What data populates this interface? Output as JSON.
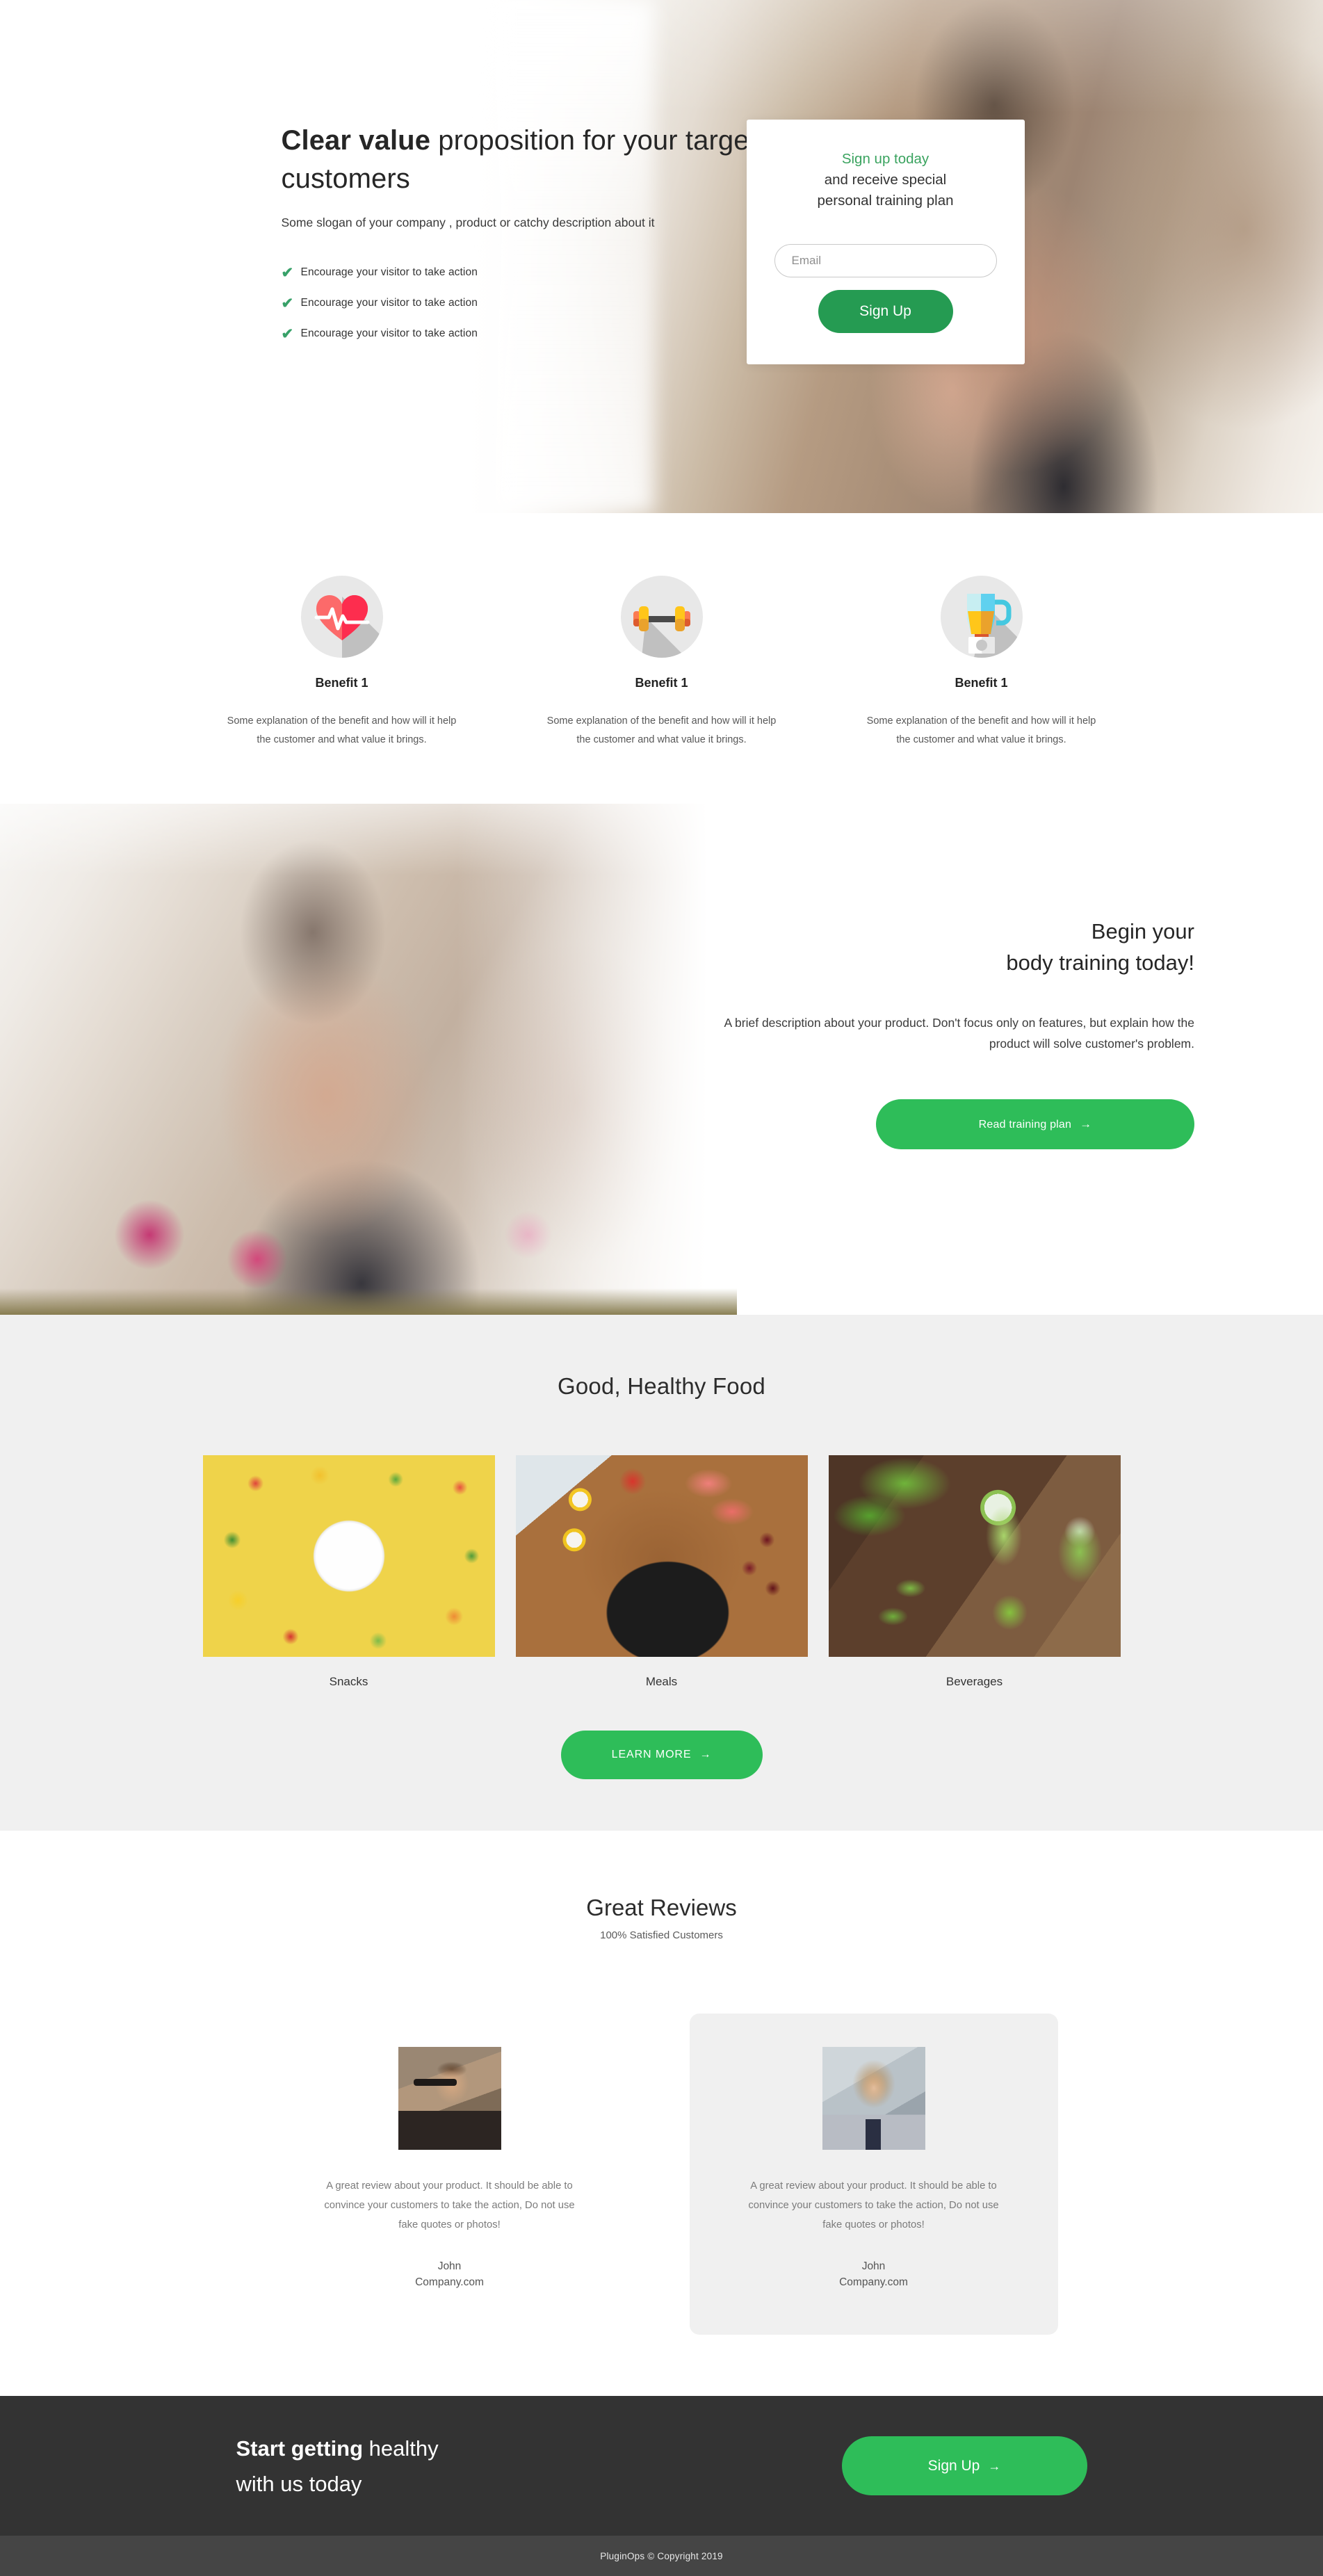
{
  "hero": {
    "title_strong": "Clear value",
    "title_rest": " proposition for your target customers",
    "subtitle": "Some slogan of your company , product or catchy description about it",
    "bullets": [
      "Encourage your visitor to take action",
      "Encourage your visitor to take action",
      "Encourage your visitor to take action"
    ],
    "check_color": "#38a169",
    "signup": {
      "headline_green": "Sign up today",
      "headline_line2": "and receive special",
      "headline_line3": "personal training plan",
      "email_placeholder": "Email",
      "email_value": "",
      "button_label": "Sign Up",
      "button_color": "#259b52"
    }
  },
  "benefits": [
    {
      "icon": "heartbeat-icon",
      "title": "Benefit 1",
      "description": "Some explanation of the benefit and how will it help the customer and what value it brings."
    },
    {
      "icon": "dumbbell-icon",
      "title": "Benefit 1",
      "description": "Some explanation of the benefit and how will it help the customer and what value it brings."
    },
    {
      "icon": "blender-icon",
      "title": "Benefit 1",
      "description": "Some explanation of the benefit and how will it help the customer and what value it brings."
    }
  ],
  "training": {
    "title_line1": "Begin your",
    "title_line2": "body training today!",
    "description": "A brief description about your product. Don't focus only on features, but explain how the product will solve customer's problem.",
    "button_label": "Read training plan",
    "button_arrow": "→",
    "button_color": "#2ebd59",
    "image_alt": "woman-lifting-pink-dumbbell"
  },
  "food": {
    "title": "Good, Healthy Food",
    "background_color": "#f0f0f0",
    "cards": [
      {
        "caption": "Snacks",
        "image_alt": "fruit-bowl-photo"
      },
      {
        "caption": "Meals",
        "image_alt": "avocado-egg-plate-photo"
      },
      {
        "caption": "Beverages",
        "image_alt": "green-smoothie-photo"
      }
    ],
    "learn_more_label": "LEARN MORE",
    "learn_more_arrow": "→"
  },
  "reviews": {
    "title": "Great Reviews",
    "subtitle": "100% Satisfied Customers",
    "items": [
      {
        "avatar_alt": "man-with-glasses-photo",
        "quote": "A great review about your product. It should be able to convince your customers to take the action, Do not use fake quotes or photos!",
        "name": "John",
        "company": "Company.com",
        "shaded": false
      },
      {
        "avatar_alt": "smiling-woman-photo",
        "quote": "A great review about your product. It should be able to convince your customers to take the action, Do not use fake quotes or photos!",
        "name": "John",
        "company": "Company.com",
        "shaded": true
      }
    ]
  },
  "cta": {
    "headline_strong": "Start getting",
    "headline_rest": " healthy",
    "headline_line2": "with us today",
    "button_label": "Sign Up",
    "button_arrow": "→",
    "background_color": "#333333",
    "button_color": "#2ebd59"
  },
  "footer": {
    "copyright": "PluginOps  © Copyright 2019",
    "background_color": "#454545"
  }
}
